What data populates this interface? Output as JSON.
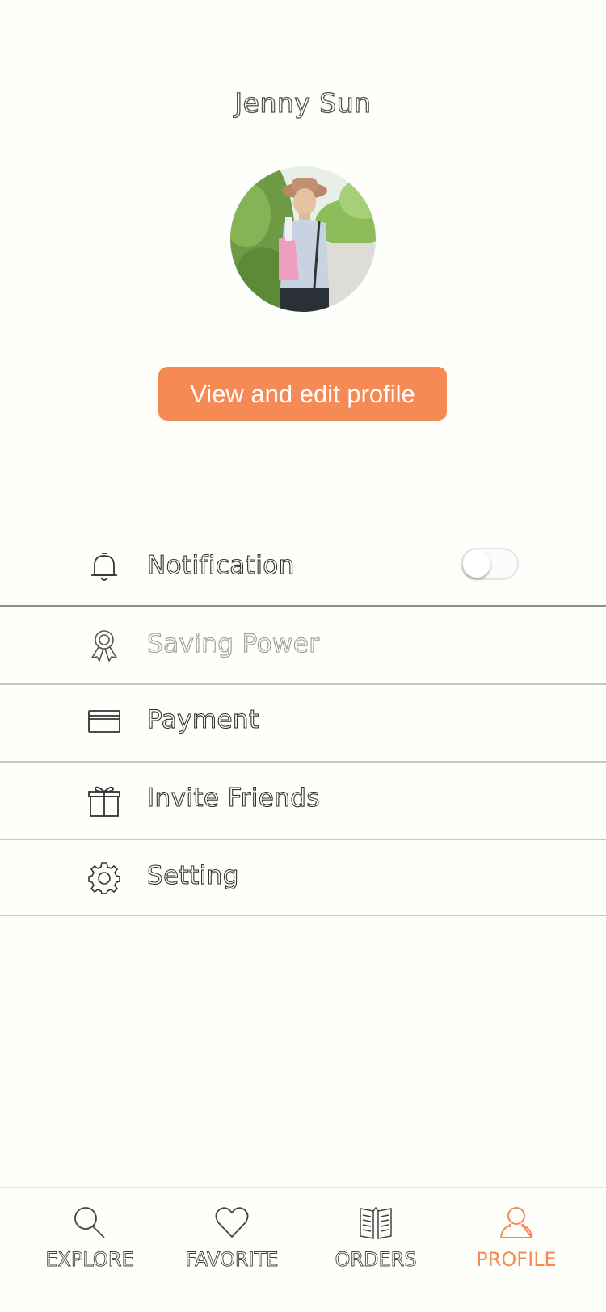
{
  "profile": {
    "name": "Jenny Sun",
    "edit_button_label": "View and edit profile"
  },
  "menu": {
    "notification": {
      "label": "Notification",
      "icon": "bell-icon",
      "toggle_on": false
    },
    "saving_power": {
      "label": "Saving Power",
      "icon": "award-ribbon-icon"
    },
    "payment": {
      "label": "Payment",
      "icon": "credit-card-icon"
    },
    "invite_friends": {
      "label": "Invite Friends",
      "icon": "gift-icon"
    },
    "setting": {
      "label": "Setting",
      "icon": "gear-icon"
    }
  },
  "tabbar": {
    "explore": {
      "label": "EXPLORE",
      "icon": "search-icon"
    },
    "favorite": {
      "label": "FAVORITE",
      "icon": "heart-icon"
    },
    "orders": {
      "label": "ORDERS",
      "icon": "menu-book-icon"
    },
    "profile": {
      "label": "PROFILE",
      "icon": "person-icon",
      "active": true
    }
  },
  "colors": {
    "accent": "#f58a55",
    "background": "#fefefb",
    "divider": "#c8c8c8"
  }
}
